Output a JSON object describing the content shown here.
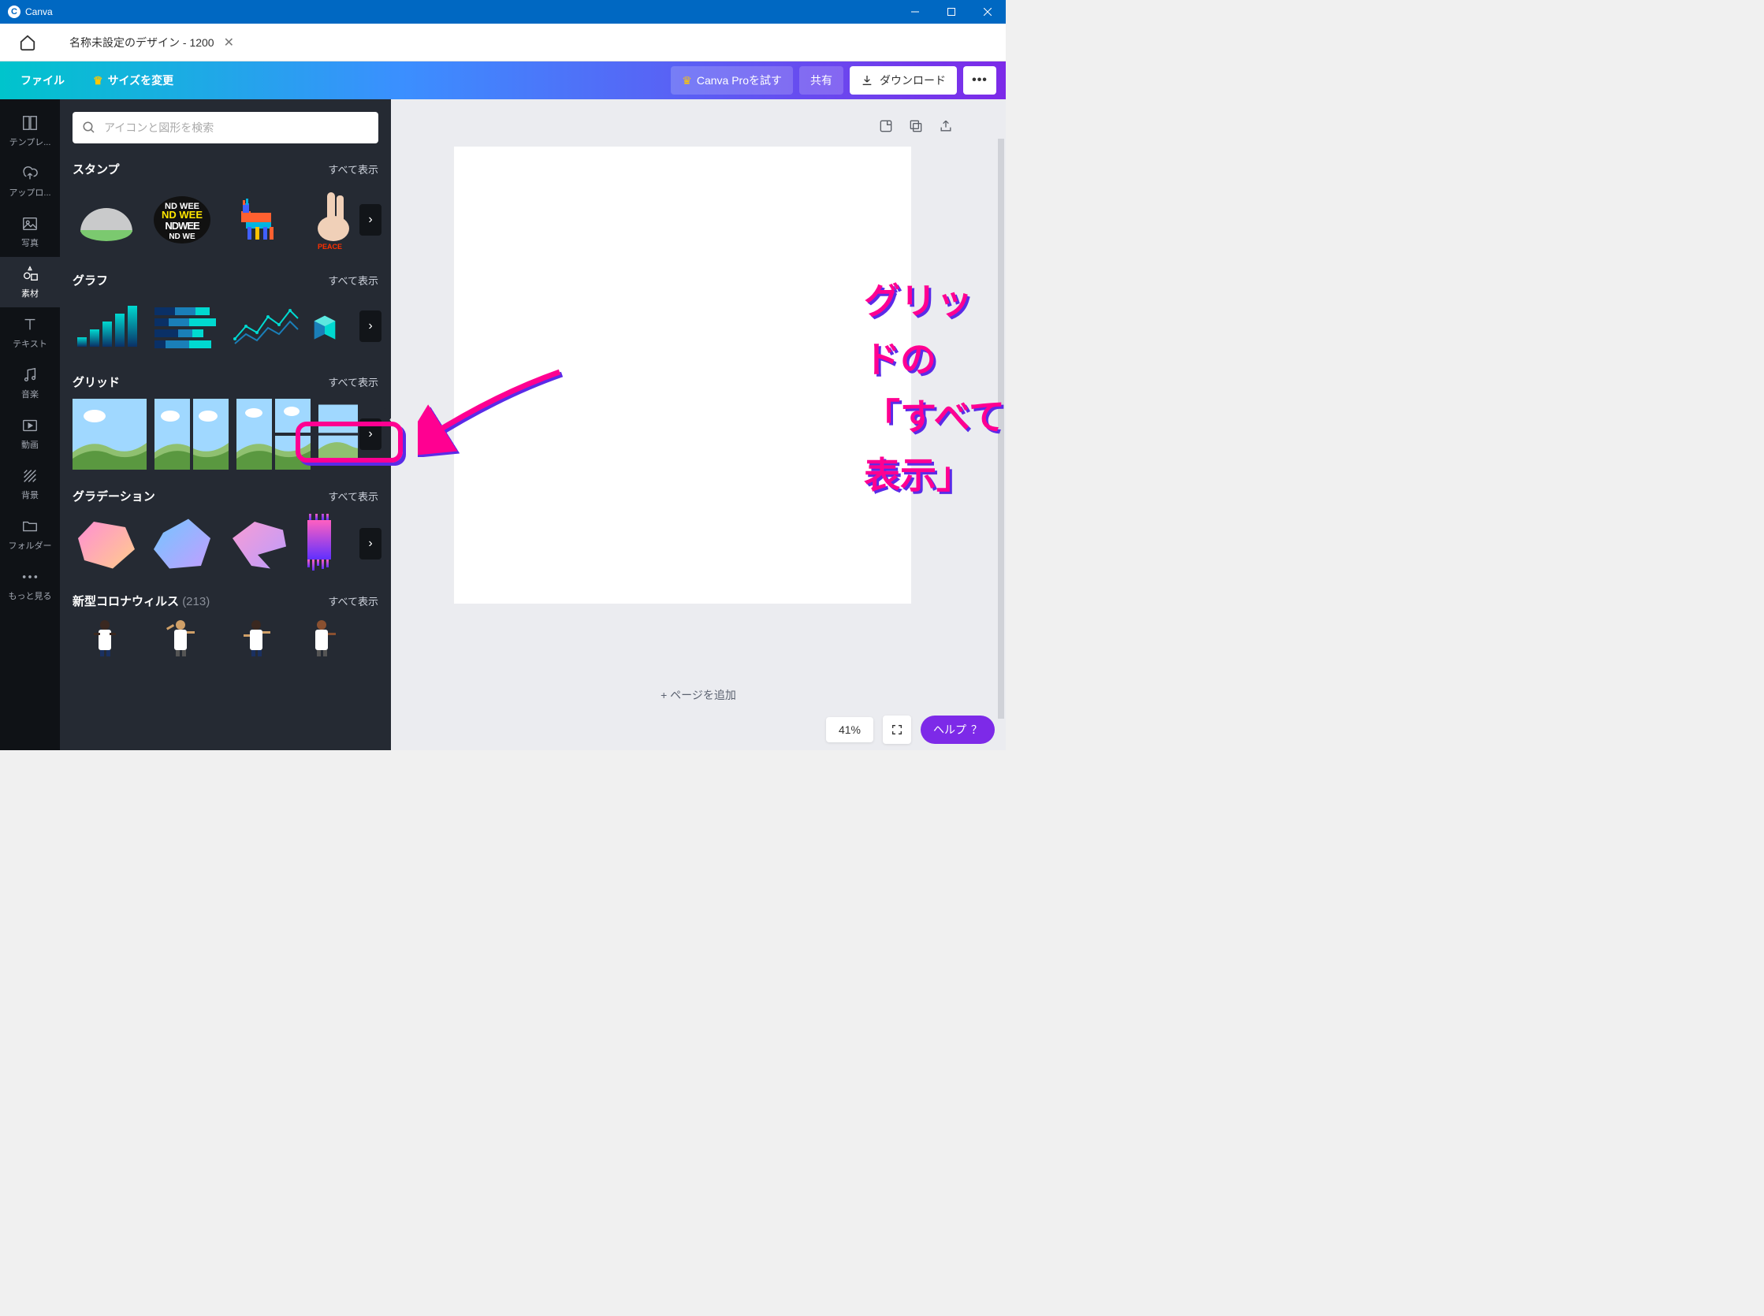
{
  "titlebar": {
    "app": "Canva"
  },
  "tab": {
    "title": "名称未設定のデザイン - 1200"
  },
  "toolbar": {
    "file": "ファイル",
    "resize": "サイズを変更",
    "trypro": "Canva Proを試す",
    "share": "共有",
    "download": "ダウンロード"
  },
  "search": {
    "placeholder": "アイコンと図形を検索"
  },
  "sidenav": {
    "templates": "テンプレ...",
    "upload": "アップロ...",
    "photo": "写真",
    "elements": "素材",
    "text": "テキスト",
    "music": "音楽",
    "video": "動画",
    "background": "背景",
    "folder": "フォルダー",
    "more": "もっと見る"
  },
  "sections": {
    "stamp": {
      "title": "スタンプ",
      "all": "すべて表示"
    },
    "chart": {
      "title": "グラフ",
      "all": "すべて表示"
    },
    "grid": {
      "title": "グリッド",
      "all": "すべて表示"
    },
    "gradient": {
      "title": "グラデーション",
      "all": "すべて表示"
    },
    "covid": {
      "title": "新型コロナウィルス",
      "count": "(213)",
      "all": "すべて表示"
    }
  },
  "canvas": {
    "addpage": "+ ページを追加",
    "zoom": "41%",
    "help": "ヘルプ",
    "helpmark": "？"
  },
  "annotation": {
    "line1": "グリッドの",
    "line2": "「すべて表示」"
  }
}
